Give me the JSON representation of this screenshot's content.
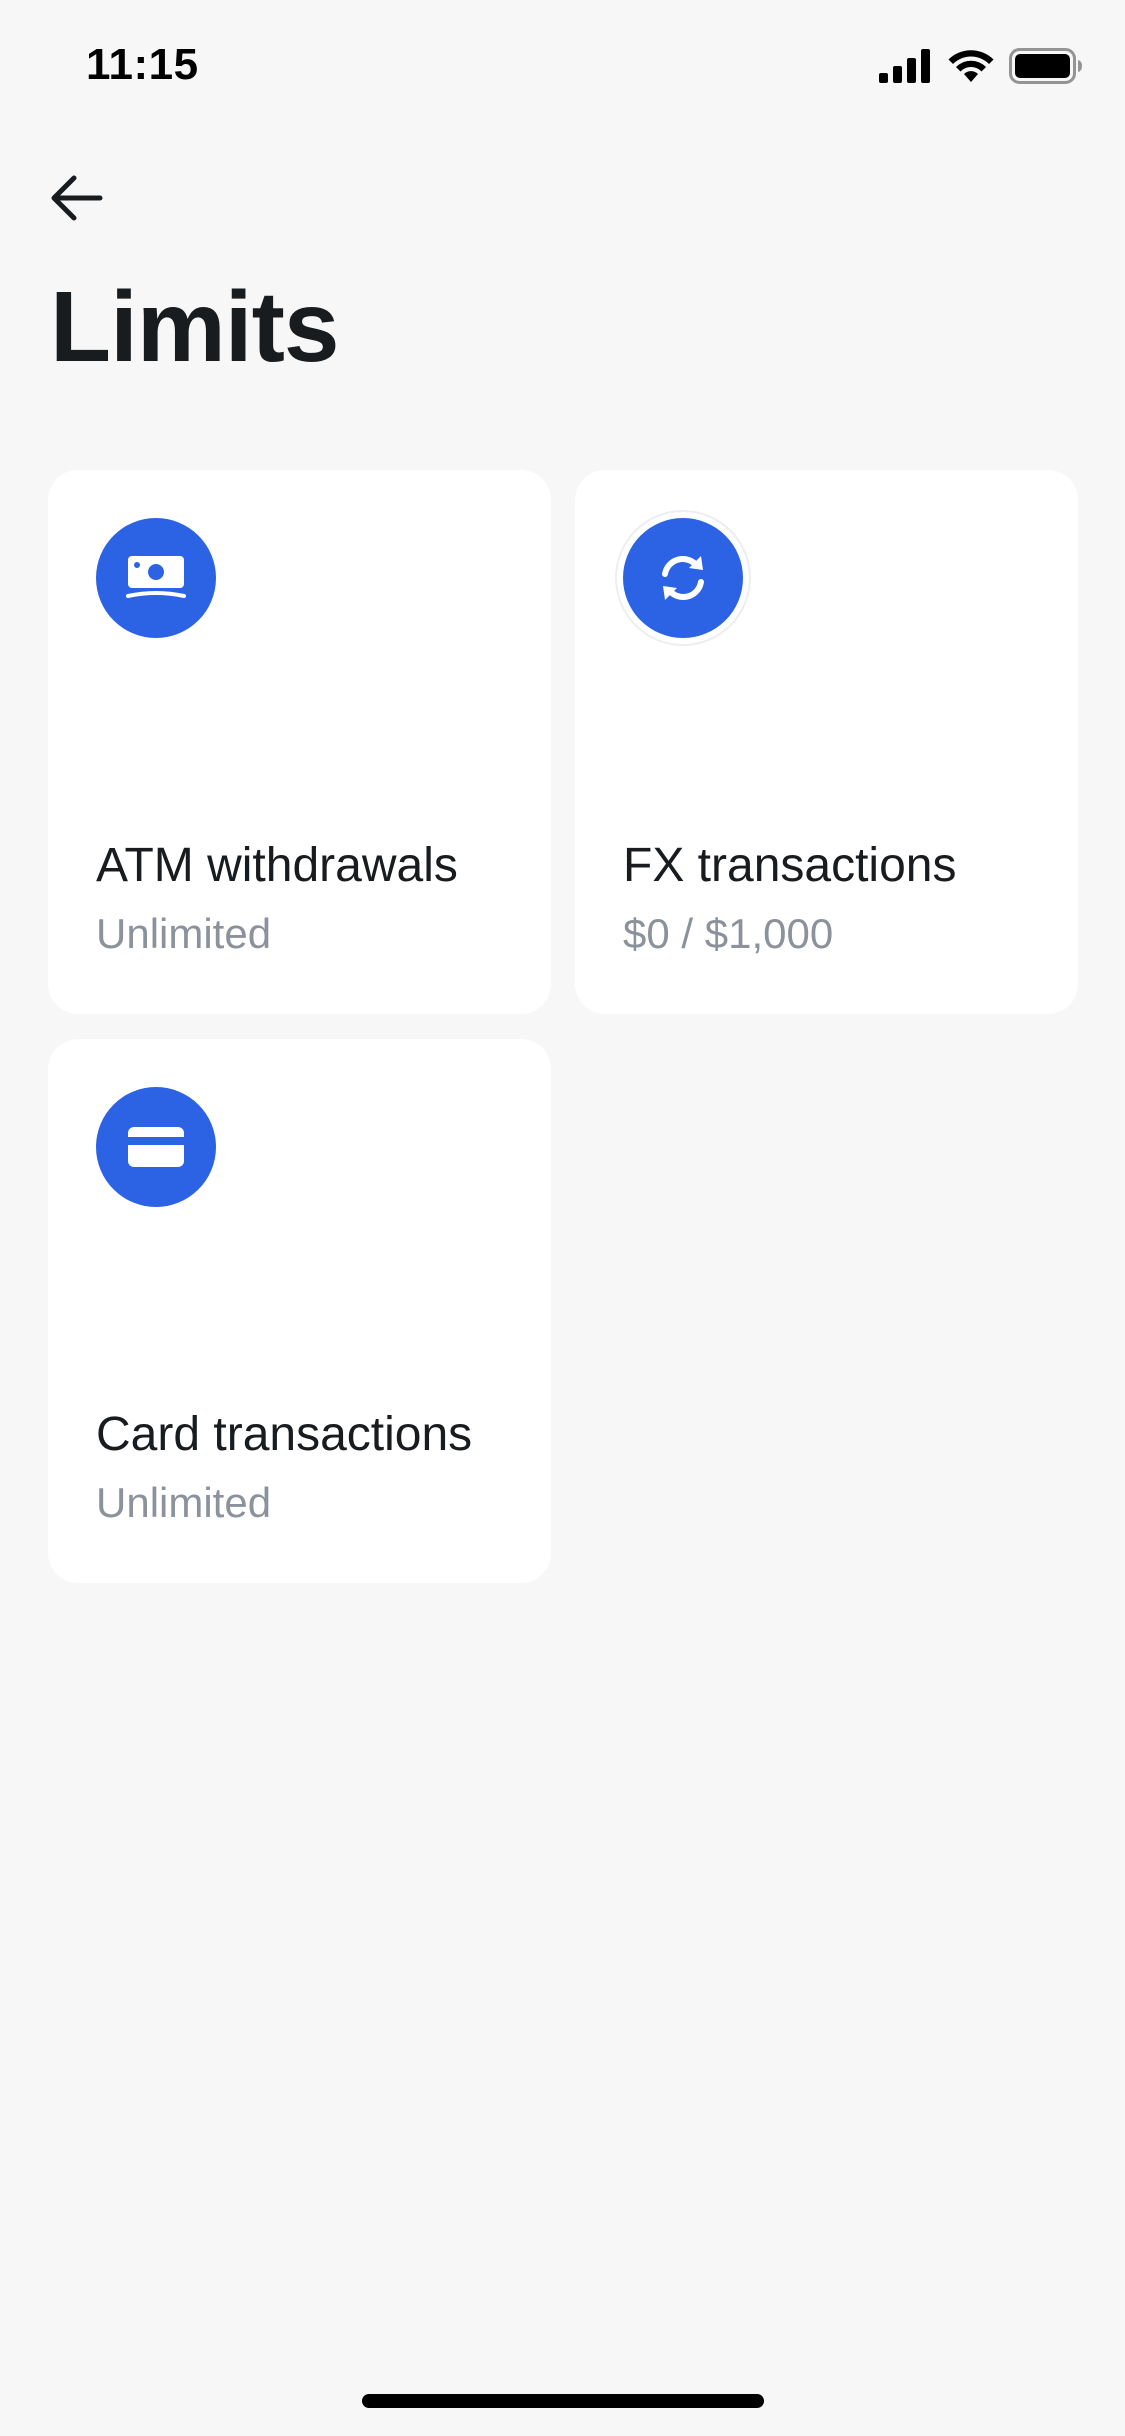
{
  "status_bar": {
    "time": "11:15",
    "icons": [
      "signal-icon",
      "wifi-icon",
      "battery-icon"
    ]
  },
  "header": {
    "back_icon": "arrow-left-icon",
    "title": "Limits"
  },
  "limits": [
    {
      "title": "ATM withdrawals",
      "value": "Unlimited",
      "icon": "cash-icon"
    },
    {
      "title": "FX transactions",
      "value": "$0 / $1,000",
      "icon": "exchange-icon"
    },
    {
      "title": "Card transactions",
      "value": "Unlimited",
      "icon": "card-icon"
    }
  ],
  "colors": {
    "accent": "#2c63e4",
    "background": "#f7f7f7",
    "card": "#ffffff",
    "text_primary": "#191c1f",
    "text_secondary": "#8b929c"
  }
}
